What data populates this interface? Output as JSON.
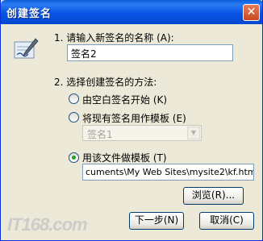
{
  "window": {
    "title": "创建签名",
    "close_glyph": "✕"
  },
  "step1": {
    "label": "1. 请输入新签名的名称 (A):",
    "name_value": "签名2"
  },
  "step2": {
    "label": "2. 选择创建签名的方法:",
    "options": [
      {
        "label": "由空白签名开始 (K)",
        "checked": false,
        "disabled": false
      },
      {
        "label": "将现有签名用作模板 (E)",
        "checked": false,
        "disabled": false
      },
      {
        "label": "用该文件做模板 (T)",
        "checked": true,
        "disabled": false
      }
    ],
    "template_combo_value": "签名1",
    "file_path_value": "cuments\\My Web Sites\\mysite2\\kf.htm"
  },
  "buttons": {
    "browse": "浏览(R)...",
    "next": "下一步(N)",
    "cancel": "取消(C)"
  },
  "watermark": "IT168.com",
  "icons": {
    "app": "signature-pen-icon",
    "close": "close-icon"
  }
}
